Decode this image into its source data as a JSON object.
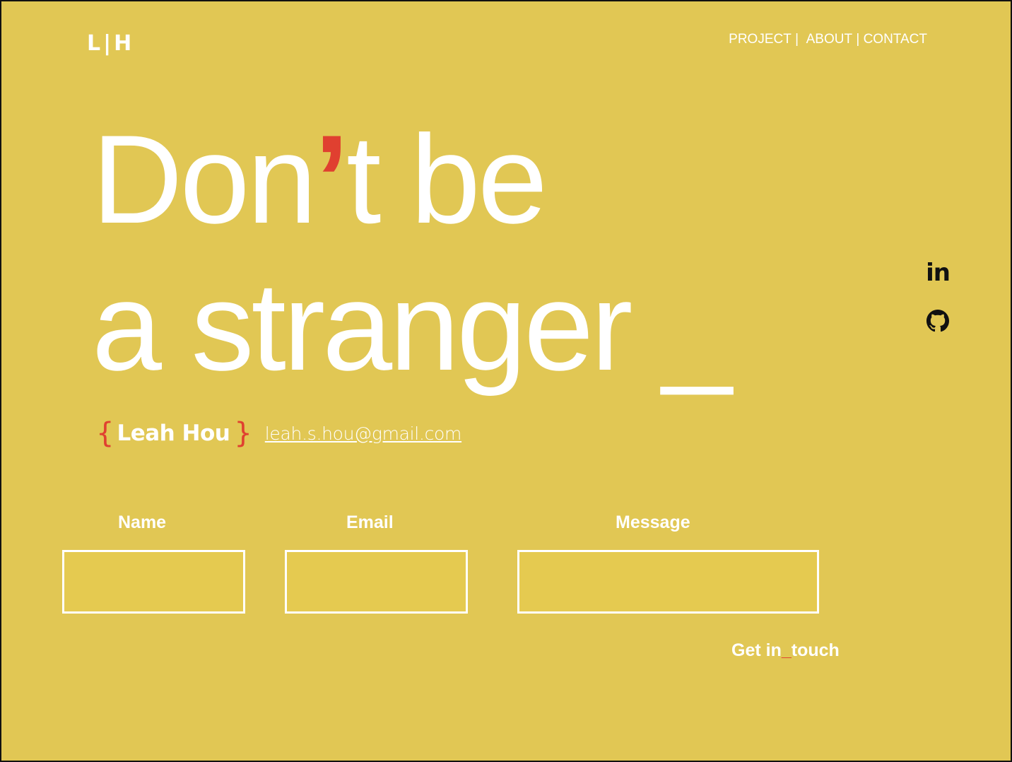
{
  "colors": {
    "background": "#E1C754",
    "text": "#FFFFFF",
    "accent": "#E04030",
    "border": "#111111",
    "icon": "#111111"
  },
  "header": {
    "logo": "L|H",
    "nav": [
      {
        "label": "PROJECT"
      },
      {
        "label": "ABOUT"
      },
      {
        "label": "CONTACT"
      }
    ],
    "separator": "|"
  },
  "hero": {
    "line1_part1": "Don",
    "apostrophe": "’",
    "line1_part2": "t be",
    "line2": "a stranger _"
  },
  "social": {
    "linkedin_label": "in",
    "linkedin_icon": "linkedin-icon",
    "github_icon": "github-icon"
  },
  "identity": {
    "brace_open": "{",
    "name": "Leah Hou",
    "brace_close": "}",
    "email": "leah.s.hou@gmail.com"
  },
  "form": {
    "name_label": "Name",
    "email_label": "Email",
    "message_label": "Message",
    "name_value": "",
    "email_value": "",
    "message_value": "",
    "submit_part1": "Get in",
    "submit_underscore": "_",
    "submit_part2": "touch"
  }
}
